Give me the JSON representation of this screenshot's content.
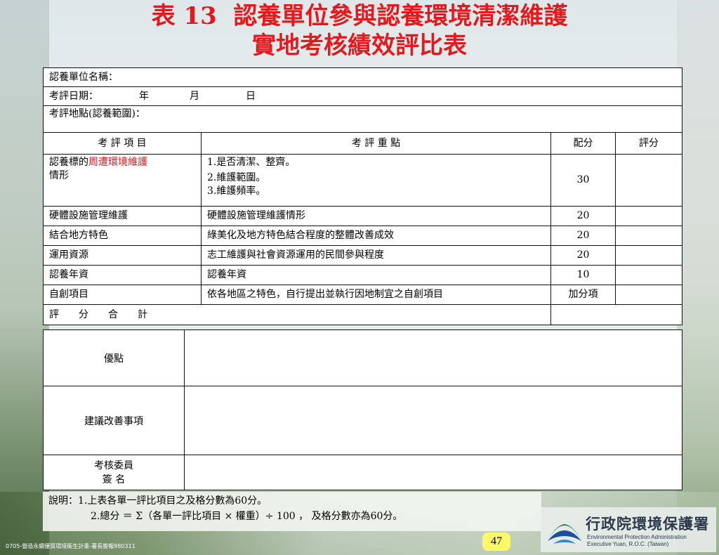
{
  "title": {
    "line1": "表 13  認養單位參與認養環境清潔維護",
    "line2": "實地考核績效評比表"
  },
  "form": {
    "unit_name_label": "認養單位名稱：",
    "date_label": "考評日期：",
    "date_year": "年",
    "date_month": "月",
    "date_day": "日",
    "location_label": "考評地點(認養範圍)："
  },
  "table": {
    "headers": {
      "item": "考 評 項 目",
      "focus": "考 評 重 點",
      "points": "配分",
      "score": "評分"
    },
    "rows": [
      {
        "item_prefix": "認養標的",
        "item_red": "周遭環境維護",
        "item_suffix": "情形",
        "focus_lines": [
          "1.是否清潔、整齊。",
          "2.維護範圍。",
          "3.維護頻率。"
        ],
        "points": "30"
      },
      {
        "item_red": "硬體設施管理維護",
        "focus": "硬體設施管理維護情形",
        "points": "20"
      },
      {
        "item": "結合地方特色",
        "focus": "綠美化及地方特色結合程度的整體改善成效",
        "points": "20"
      },
      {
        "item": "運用資源",
        "focus": "志工維護與社會資源運用的民間參與程度",
        "points": "20"
      },
      {
        "item": "認養年資",
        "focus": "認養年資",
        "points": "10"
      },
      {
        "item_red": "自創項目",
        "focus_red": "依各地區之特色，自行提出並執行因地制宜之自創項目",
        "points": "加分項"
      }
    ],
    "total_label": "評　　分　　合　　計"
  },
  "lower": {
    "advantages_label": "優點",
    "suggestions_label": "建議改善事項",
    "reviewer_label_1": "考核委員",
    "reviewer_label_2": "簽 名"
  },
  "notes": {
    "line1": "說明：1.上表各單一評比項目之及格分數為60分。",
    "line2": "2.總分 ＝ Σ（各單一評比項目 × 權重）÷ 100 ， 及格分數亦為60分。"
  },
  "page_number": "47",
  "footer_small": "0705-營造永續優質環境衛生計畫-署長簽報980311",
  "logo": {
    "name_cn": "行政院環境保護署",
    "name_en_1": "Environmental Protection Administration",
    "name_en_2": "Executive Yuan, R.O.C. (Taiwan)"
  },
  "colors": {
    "title_red": "#e8171b",
    "page_badge": "#fff86a"
  }
}
